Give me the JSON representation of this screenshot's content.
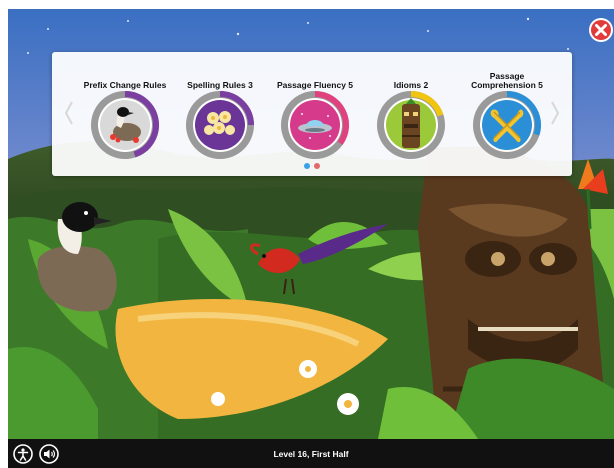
{
  "activities": [
    {
      "label": "Prefix Change Rules",
      "icon": "nene-goose-icon",
      "progress": 0.45,
      "ring_color": "#7a3fa0"
    },
    {
      "label": "Spelling Rules 3",
      "icon": "plumeria-flowers-icon",
      "progress": 0.25,
      "ring_color": "#7a3fa0"
    },
    {
      "label": "Passage Fluency 5",
      "icon": "spaceship-icon",
      "progress": 0.35,
      "ring_color": "#e0427f"
    },
    {
      "label": "Idioms 2",
      "icon": "tiki-icon",
      "progress": 0.2,
      "ring_color": "#f1c40f"
    },
    {
      "label": "Passage Comprehension 5",
      "icon": "crossed-paddles-icon",
      "progress": 0.3,
      "ring_color": "#2a8fd6"
    }
  ],
  "pager": {
    "pages": 2,
    "current": 1
  },
  "footer": {
    "status": "Level 16, First Half"
  },
  "colors": {
    "close": "#e23b3b",
    "footer": "#111111",
    "dot_active": "#3aa0e8",
    "dot_inactive": "#e26a6a"
  }
}
